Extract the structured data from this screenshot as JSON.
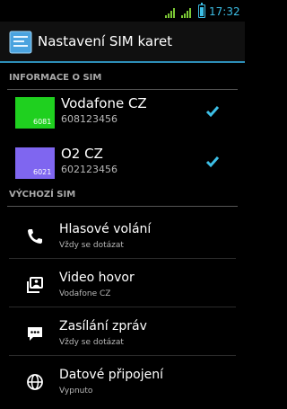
{
  "status_bar": {
    "time": "17:32",
    "icons": [
      "signal-icon-1",
      "signal-icon-2",
      "battery-icon"
    ]
  },
  "header": {
    "title": "Nastavení SIM karet",
    "icon": "sim-settings-icon"
  },
  "sim_info": {
    "heading": "INFORMACE O SIM",
    "items": [
      {
        "name": "Vodafone CZ",
        "number": "608123456",
        "badge_text": "6081",
        "color": "#1fd01f",
        "checked": true
      },
      {
        "name": "O2 CZ",
        "number": "602123456",
        "badge_text": "6021",
        "color": "#7f66f0",
        "checked": true
      }
    ]
  },
  "default_sim": {
    "heading": "VÝCHOZÍ SIM",
    "items": [
      {
        "label": "Hlasové volání",
        "sub": "Vždy se dotázat",
        "icon": "phone-icon"
      },
      {
        "label": "Video hovor",
        "sub": "Vodafone CZ",
        "icon": "video-call-icon"
      },
      {
        "label": "Zasílání zpráv",
        "sub": "Vždy se dotázat",
        "icon": "message-icon"
      },
      {
        "label": "Datové připojení",
        "sub": "Vypnuto",
        "icon": "globe-icon"
      }
    ]
  },
  "colors": {
    "accent": "#3dbfe6",
    "divider": "#2d8fb8"
  }
}
